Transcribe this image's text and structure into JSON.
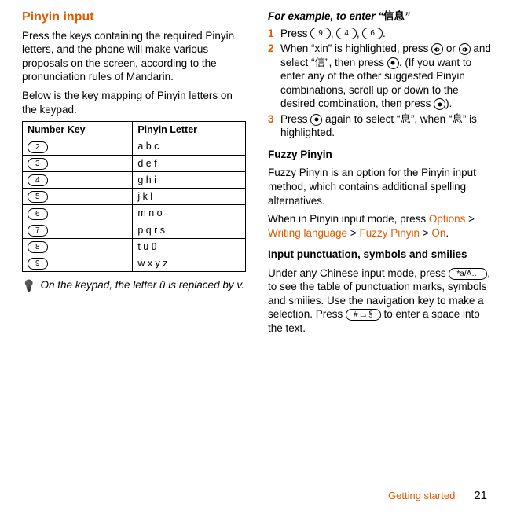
{
  "left": {
    "title": "Pinyin input",
    "intro": "Press the keys containing the required Pinyin letters, and the phone will make various proposals on the screen, according to the pronunciation rules of Mandarin.",
    "mapping_intro": "Below is the key mapping of Pinyin letters on the keypad.",
    "table": {
      "headers": [
        "Number Key",
        "Pinyin Letter"
      ],
      "rows": [
        {
          "key": "2",
          "letters": "a b c"
        },
        {
          "key": "3",
          "letters": "d e f"
        },
        {
          "key": "4",
          "letters": "g h i"
        },
        {
          "key": "5",
          "letters": "j k l"
        },
        {
          "key": "6",
          "letters": "m n o"
        },
        {
          "key": "7",
          "letters": "p q r s"
        },
        {
          "key": "8",
          "letters": "t u ü"
        },
        {
          "key": "9",
          "letters": "w x y z"
        }
      ]
    },
    "tip": "On the keypad, the letter ü is replaced by v."
  },
  "right": {
    "example_title_pre": "For example, to enter “",
    "example_chars": "信息",
    "example_title_post": "”",
    "steps": {
      "s1_pre": "Press ",
      "s1_k1": "9",
      "s1_c1": ", ",
      "s1_k2": "4",
      "s1_c2": ", ",
      "s1_k3": "6",
      "s1_end": ".",
      "s2_a": "When “xin” is highlighted, press ",
      "s2_b": " or ",
      "s2_c": " and select “",
      "s2_char1": "信",
      "s2_d": "”, then press ",
      "s2_e": ". (If you want to enter any of the other suggested Pinyin combinations, scroll up or down to the desired combination, then press ",
      "s2_f": ").",
      "s3_a": "Press ",
      "s3_b": " again to select “",
      "s3_char": "息",
      "s3_c": "”, when “",
      "s3_char2": "息",
      "s3_d": "” is highlighted."
    },
    "fuzzy": {
      "heading": "Fuzzy Pinyin",
      "body": "Fuzzy Pinyin is an option for the Pinyin input method, which contains additional spelling alternatives.",
      "body2_pre": "When in Pinyin input mode, press ",
      "opt1": "Options",
      "gt": " > ",
      "opt2": "Writing language",
      "opt3": "Fuzzy Pinyin",
      "opt4": "On",
      "body2_post": "."
    },
    "punct": {
      "heading": "Input punctuation, symbols and smilies",
      "body_a": "Under any Chinese input mode, press ",
      "key1": "*a/A…",
      "body_b": ", to see the table of punctuation marks, symbols and smilies. Use the navigation key to make a selection. Press ",
      "key2": "# ⌴ §",
      "body_c": " to enter a space into the text."
    }
  },
  "footer": {
    "section": "Getting started",
    "page": "21"
  }
}
